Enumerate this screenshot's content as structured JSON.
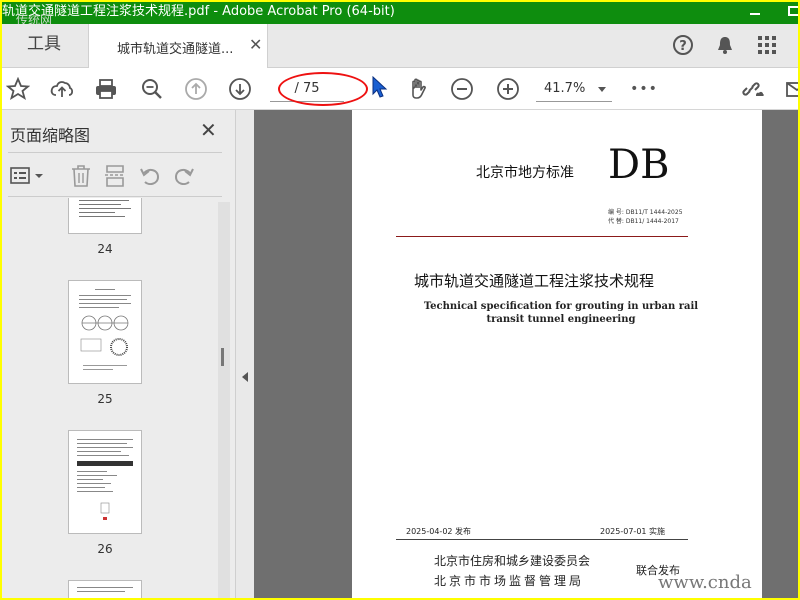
{
  "window": {
    "title": "轨道交通隧道工程注浆技术规程.pdf - Adobe Acrobat Pro (64-bit)",
    "watermark_top": "传统网"
  },
  "tabs": {
    "tools_label": "工具",
    "doc_tab_label": "城市轨道交通隧道..."
  },
  "toolbar": {
    "page_input": "/ 75",
    "zoom_value": "41.7%",
    "more_label": "•••"
  },
  "left_panel": {
    "title": "页面缩略图",
    "thumbnails": [
      {
        "page": "24"
      },
      {
        "page": "25"
      },
      {
        "page": "26"
      }
    ]
  },
  "document": {
    "standard_label": "北京市地方标准",
    "db_mark": "DB",
    "code_line1": "编 号: DB11/T 1444-2025",
    "code_line2": "代 替: DB11/ 1444-2017",
    "title_cn": "城市轨道交通隧道工程注浆技术规程",
    "title_en_line1": "Technical specification for grouting in urban rail",
    "title_en_line2": "transit tunnel engineering",
    "issue_date": "2025-04-02 发布",
    "impl_date": "2025-07-01 实施",
    "org1": "北京市住房和城乡建设委员会",
    "org2": "北京市市场监督管理局",
    "joint": "联合发布"
  },
  "watermark": "www.cnda"
}
